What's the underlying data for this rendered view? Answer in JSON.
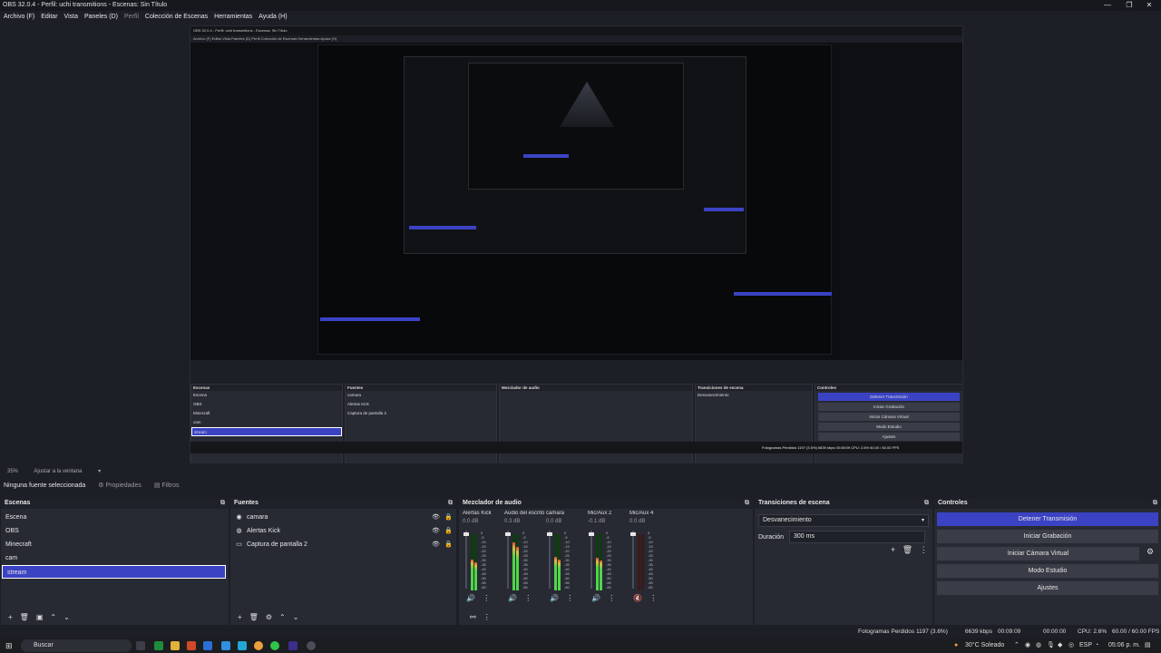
{
  "window": {
    "title": "OBS 32.0.4 - Perfil: uchi transmitions - Escenas: Sin Título",
    "minimize": "—",
    "maximize": "❐",
    "close": "✕"
  },
  "menu": {
    "items": [
      "Archivo (F)",
      "Editar",
      "Vista",
      "Paneles (D)",
      "Perfil",
      "Colección de Escenas",
      "Herramientas",
      "Ayuda (H)"
    ]
  },
  "zoom": {
    "value": "35%",
    "fit_label": "Ajustar a la ventana"
  },
  "source_bar": {
    "no_source": "Ninguna fuente seleccionada",
    "properties": "Propiedades",
    "filters": "Filtros"
  },
  "scenes": {
    "title": "Escenas",
    "items": [
      "Escena",
      "OBS",
      "Minecraft",
      "cam",
      "stream"
    ],
    "selected_index": 4
  },
  "sources": {
    "title": "Fuentes",
    "items": [
      {
        "name": "camara",
        "icon": "camera-icon"
      },
      {
        "name": "Alertas Kick",
        "icon": "browser-icon"
      },
      {
        "name": "Captura de pantalla 2",
        "icon": "monitor-icon"
      }
    ]
  },
  "mixer": {
    "title": "Mezclador de audio",
    "channels": [
      {
        "name": "Alertas Kick",
        "db": "0.0 dB",
        "level": 0.55,
        "muted": false
      },
      {
        "name": "Audio del escritorio",
        "db": "0.3 dB",
        "level": 0.85,
        "muted": false
      },
      {
        "name": "camara",
        "db": "0.0 dB",
        "level": 0.6,
        "muted": false
      },
      {
        "name": "Mic/Aux 2",
        "db": "-0.1 dB",
        "level": 0.58,
        "muted": false
      },
      {
        "name": "Mic/Aux 4",
        "db": "0.0 dB",
        "level": 0.0,
        "muted": true
      }
    ],
    "scale": [
      "0",
      "-5",
      "-10",
      "-15",
      "-20",
      "-25",
      "-30",
      "-35",
      "-40",
      "-45",
      "-50",
      "-55",
      "-60"
    ]
  },
  "transitions": {
    "title": "Transiciones de escena",
    "selected": "Desvanecimiento",
    "duration_label": "Duración",
    "duration_value": "300 ms"
  },
  "controls": {
    "title": "Controles",
    "buttons": [
      "Detener Transmisión",
      "Iniciar Grabación",
      "Iniciar Cámara Virtual",
      "Modo Estudio",
      "Ajustes"
    ]
  },
  "status": {
    "dropped": "Fotogramas Perdidos 1197 (3.6%)",
    "bitrate": "6639 kbps",
    "time_live": "00:09:09",
    "time_rec": "00:00:00",
    "cpu": "CPU: 2.6%",
    "fps": "60.00 / 60.00 FPS"
  },
  "taskbar": {
    "search_placeholder": "Buscar",
    "weather": "30°C Soleado",
    "lang": "ESP",
    "clock": "05:06 p. m."
  },
  "nested": {
    "title": "OBS 32.0.4 - Perfil: uchi transmitions - Escenas: Sin Título",
    "menu": "Archivo (F)   Editar   Vista   Paneles (D)   Perfil   Colección de Escenas   Herramientas   Ayuda (H)",
    "status": "Fotogramas Perdidos 1197 (3.6%)      6639 kbps      00:08:09      CPU: 2.6%      60.00 / 60.00 FPS"
  },
  "colors": {
    "accent": "#3b43c4",
    "panel": "#272a33",
    "background": "#1d1f26",
    "meter_green": "#4fd64a",
    "meter_yellow": "#d9c23a",
    "meter_red": "#d84a3a"
  }
}
